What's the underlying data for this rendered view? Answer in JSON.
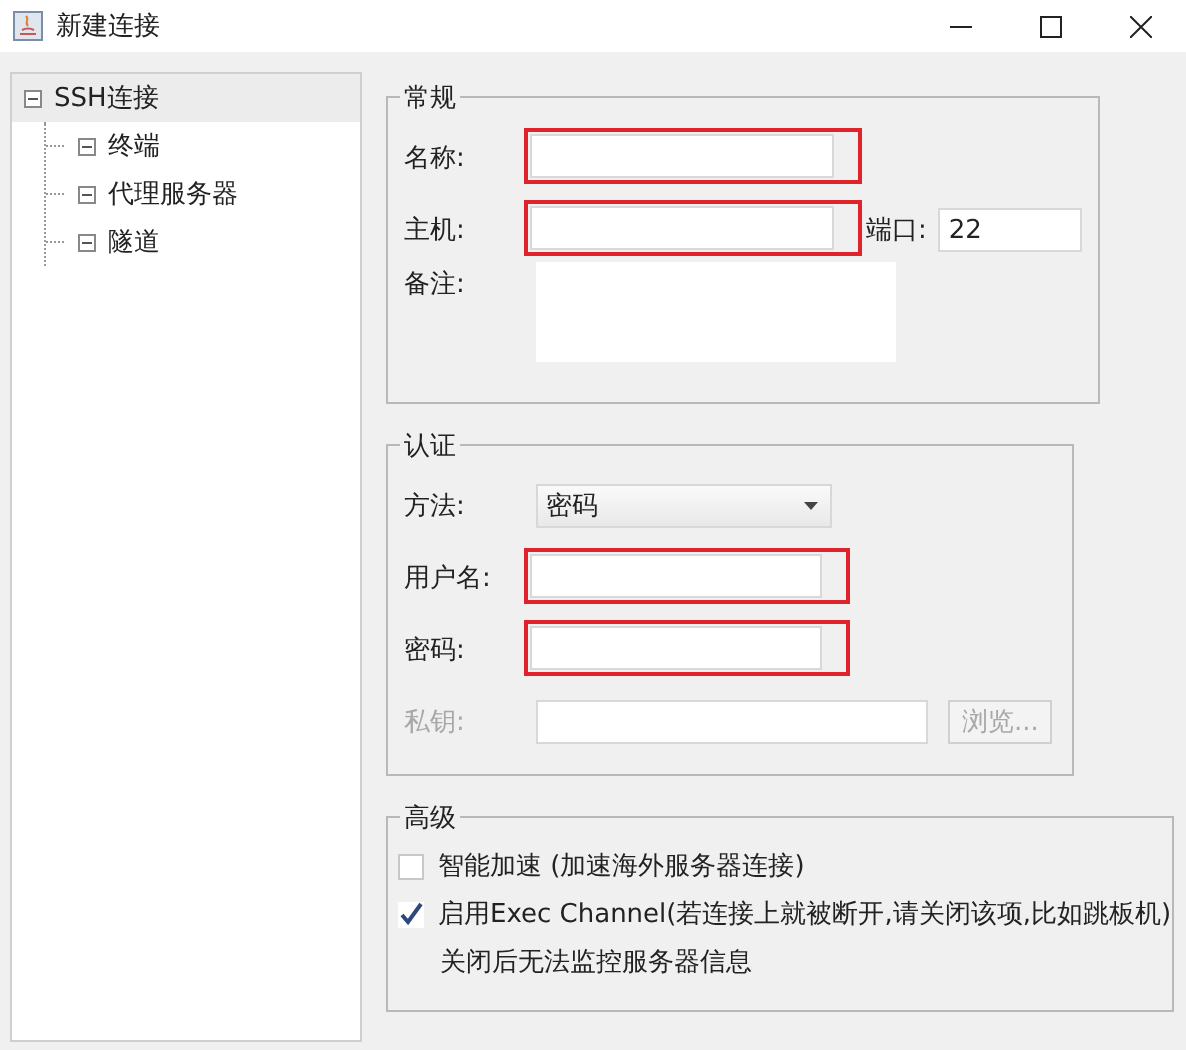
{
  "window": {
    "title": "新建连接"
  },
  "tree": [
    {
      "label": "SSH连接",
      "expanded": true,
      "selected": true,
      "children": [
        {
          "label": "终端",
          "expanded": true,
          "selected": false
        },
        {
          "label": "代理服务器",
          "expanded": true,
          "selected": false
        },
        {
          "label": "隧道",
          "expanded": true,
          "selected": false
        }
      ]
    }
  ],
  "general": {
    "title": "常规",
    "name": {
      "label": "名称:",
      "highlighted": true
    },
    "host": {
      "label": "主机:",
      "highlighted": true
    },
    "port": {
      "label": "端口:",
      "value": "22"
    },
    "note": {
      "label": "备注:"
    }
  },
  "auth": {
    "title": "认证",
    "method": {
      "label": "方法:",
      "value": "密码"
    },
    "fields": [
      {
        "kind": "text",
        "label": "用户名:",
        "highlighted": true,
        "disabled": false
      },
      {
        "kind": "text",
        "label": "密码:",
        "highlighted": true,
        "disabled": false
      },
      {
        "kind": "file",
        "label": "私钥:",
        "highlighted": false,
        "disabled": true,
        "button": "浏览..."
      }
    ]
  },
  "advanced": {
    "title": "高级",
    "options": [
      {
        "label": "智能加速 (加速海外服务器连接)",
        "checked": false
      },
      {
        "label": "启用Exec Channel(若连接上就被断开,请关闭该项,比如跳板机)",
        "checked": true
      }
    ],
    "note": "关闭后无法监控服务器信息"
  }
}
